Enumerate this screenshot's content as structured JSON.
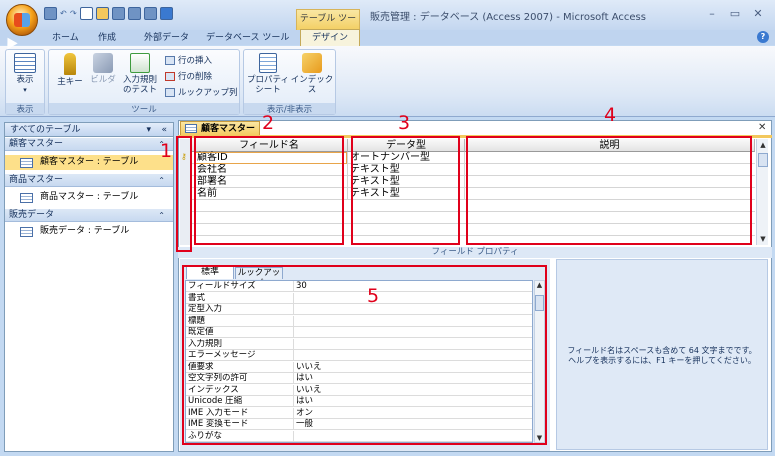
{
  "window": {
    "title": "販売管理 : データベース (Access 2007) - Microsoft Access",
    "context_tab": "テーブル ツール",
    "minimize": "–",
    "maximize": "▭",
    "close": "✕"
  },
  "ribbon_tabs": [
    "ホーム",
    "作成",
    "外部データ",
    "データベース ツール",
    "デザイン"
  ],
  "ribbon": {
    "groups": {
      "view": "表示",
      "tools": "ツール",
      "showhide": "表示/非表示"
    },
    "view_btn": "表示",
    "primary_key": "主キー",
    "builder": "ビルダ",
    "test_rules": [
      "入力規則",
      "のテスト"
    ],
    "insert_rows": "行の挿入",
    "delete_rows": "行の削除",
    "lookup_column": "ルックアップ列",
    "property_sheet": [
      "プロパティ",
      "シート"
    ],
    "indexes": "インデックス"
  },
  "nav": {
    "header": "すべてのテーブル",
    "groups": [
      {
        "name": "顧客マスター",
        "item": "顧客マスター : テーブル"
      },
      {
        "name": "商品マスター",
        "item": "商品マスター : テーブル"
      },
      {
        "name": "販売データ",
        "item": "販売データ : テーブル"
      }
    ]
  },
  "document": {
    "tab": "顧客マスター",
    "field_props_label": "フィールド プロパティ"
  },
  "design_grid": {
    "headers": [
      "フィールド名",
      "データ型",
      "説明"
    ],
    "rows": [
      {
        "field": "顧客ID",
        "type": "オートナンバー型",
        "primary_key": true
      },
      {
        "field": "会社名",
        "type": "テキスト型"
      },
      {
        "field": "部署名",
        "type": "テキスト型"
      },
      {
        "field": "名前",
        "type": "テキスト型"
      }
    ]
  },
  "properties": {
    "tabs": [
      "標準",
      "ルックアップ"
    ],
    "rows": [
      {
        "name": "フィールドサイズ",
        "value": "30"
      },
      {
        "name": "書式",
        "value": ""
      },
      {
        "name": "定型入力",
        "value": ""
      },
      {
        "name": "標題",
        "value": ""
      },
      {
        "name": "既定値",
        "value": ""
      },
      {
        "name": "入力規則",
        "value": ""
      },
      {
        "name": "エラーメッセージ",
        "value": ""
      },
      {
        "name": "値要求",
        "value": "いいえ"
      },
      {
        "name": "空文字列の許可",
        "value": "はい"
      },
      {
        "name": "インデックス",
        "value": "いいえ"
      },
      {
        "name": "Unicode 圧縮",
        "value": "はい"
      },
      {
        "name": "IME 入力モード",
        "value": "オン"
      },
      {
        "name": "IME 変換モード",
        "value": "一般"
      },
      {
        "name": "ふりがな",
        "value": ""
      }
    ],
    "help": [
      "フィールド名はスペースも含めて 64 文字までです。",
      "ヘルプを表示するには、F1 キーを押してください。"
    ]
  },
  "annotations": [
    "1",
    "2",
    "3",
    "4",
    "5"
  ],
  "colors": {
    "annotation": "#e0001b",
    "selected": "#fde08a"
  }
}
